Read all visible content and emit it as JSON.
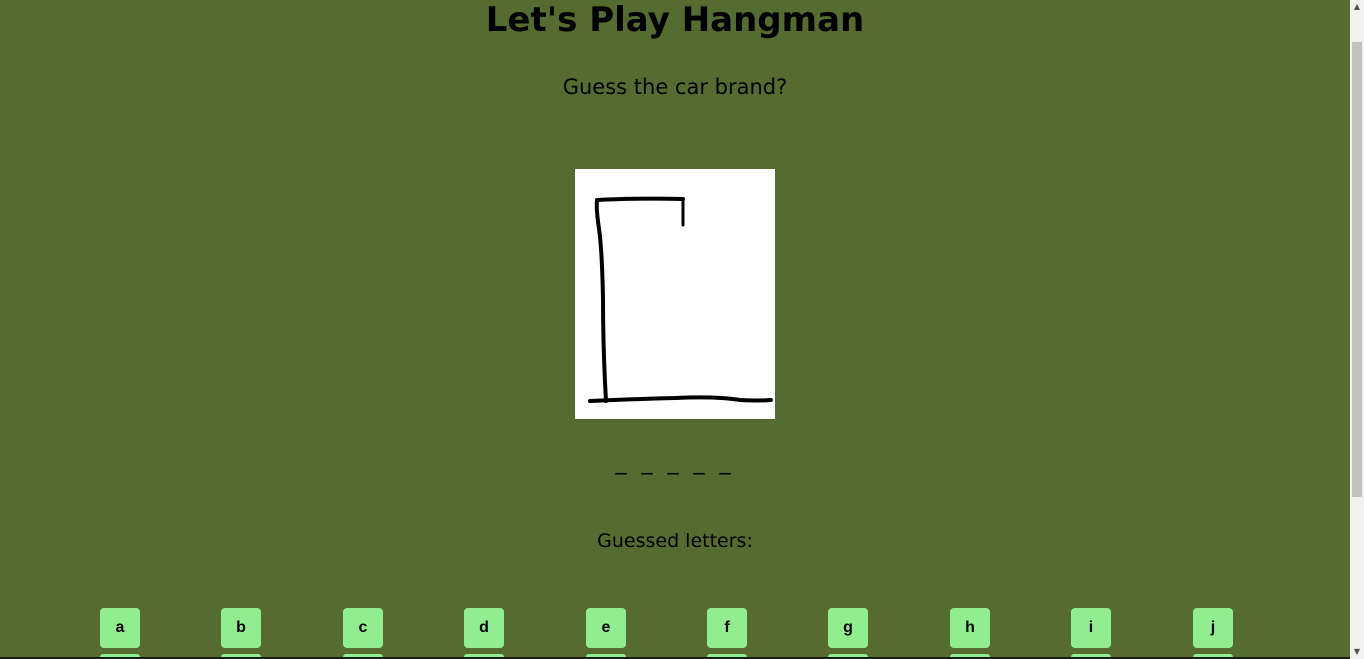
{
  "header": {
    "title": "Let's Play Hangman"
  },
  "question": "Guess the car brand?",
  "word_blanks": "_ _ _ _ _",
  "guessed_label": "Guessed letters:",
  "letters_row1": [
    "a",
    "b",
    "c",
    "d",
    "e",
    "f",
    "g",
    "h",
    "i",
    "j"
  ],
  "colors": {
    "background": "#556b2f",
    "key_background": "#90ee90",
    "gallows_canvas": "#ffffff"
  }
}
